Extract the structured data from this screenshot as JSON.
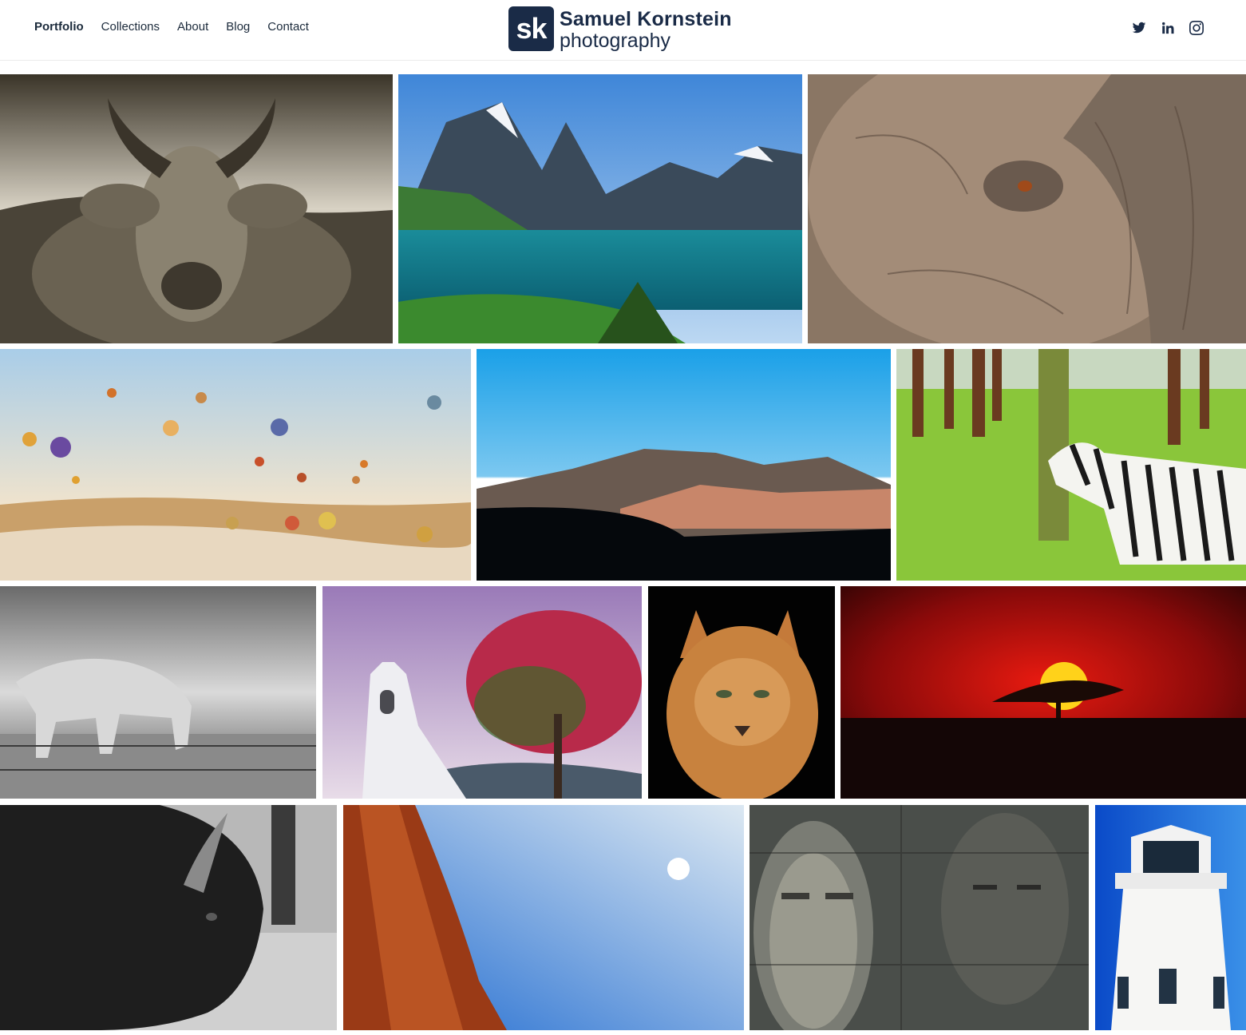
{
  "brand": {
    "mark": "sk",
    "name": "Samuel Kornstein",
    "sub": "photography"
  },
  "nav": {
    "items": [
      {
        "label": "Portfolio",
        "active": true
      },
      {
        "label": "Collections"
      },
      {
        "label": "About"
      },
      {
        "label": "Blog"
      },
      {
        "label": "Contact"
      }
    ]
  },
  "social": [
    "twitter-icon",
    "linkedin-icon",
    "instagram-icon"
  ],
  "gallery": [
    {
      "subject": "cow",
      "tone": "sepia"
    },
    {
      "subject": "fjord",
      "tone": "color"
    },
    {
      "subject": "elephant",
      "tone": "color"
    },
    {
      "subject": "balloons",
      "tone": "color"
    },
    {
      "subject": "volcano",
      "tone": "color"
    },
    {
      "subject": "zebra",
      "tone": "color"
    },
    {
      "subject": "horse",
      "tone": "bw"
    },
    {
      "subject": "bell-tower",
      "tone": "color"
    },
    {
      "subject": "caracal",
      "tone": "color"
    },
    {
      "subject": "sunset",
      "tone": "color"
    },
    {
      "subject": "bison",
      "tone": "bw"
    },
    {
      "subject": "canyon",
      "tone": "color"
    },
    {
      "subject": "stone-face",
      "tone": "color"
    },
    {
      "subject": "lighthouse",
      "tone": "color"
    }
  ]
}
